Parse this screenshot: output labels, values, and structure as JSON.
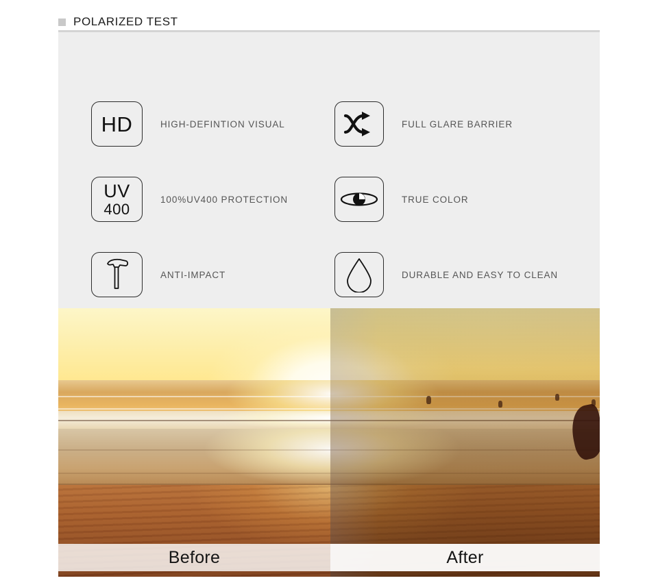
{
  "header": {
    "bullet_icon": "square-bullet-icon",
    "title": "POLARIZED TEST"
  },
  "features": [
    {
      "icon_name": "hd-icon",
      "icon_text": "HD",
      "label": "HIGH-DEFINTION VISUAL"
    },
    {
      "icon_name": "shuffle-arrows-icon",
      "icon_text": "",
      "label": "FULL GLARE BARRIER"
    },
    {
      "icon_name": "uv400-icon",
      "icon_text_top": "UV",
      "icon_text_bottom": "400",
      "label": "100%UV400 PROTECTION"
    },
    {
      "icon_name": "eye-icon",
      "icon_text": "",
      "label": "TRUE COLOR"
    },
    {
      "icon_name": "hammer-icon",
      "icon_text": "",
      "label": "ANTI-IMPACT"
    },
    {
      "icon_name": "water-drop-icon",
      "icon_text": "",
      "label": "DURABLE AND EASY TO CLEAN"
    }
  ],
  "comparison": {
    "before_label": "Before",
    "after_label": "After",
    "scene": "sunset beach with ocean waves and sand"
  },
  "colors": {
    "panel_background": "#eeeeee",
    "page_background": "#ffffff",
    "rule": "#d4d4d4",
    "bullet": "#c9c9c9",
    "title_text": "#1c1c1c",
    "label_text": "#555555",
    "icon_stroke": "#2b2b2b"
  }
}
